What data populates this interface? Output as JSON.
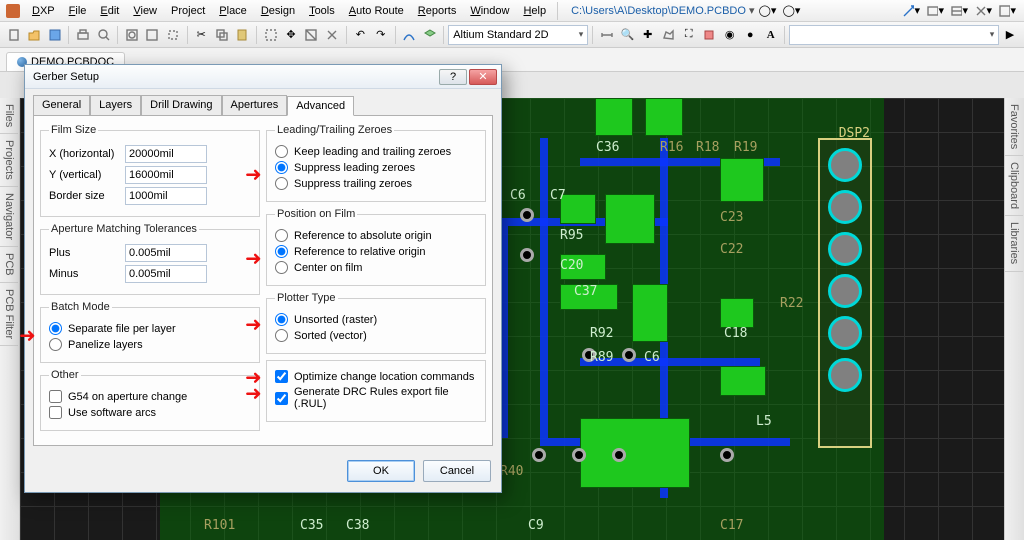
{
  "menu": [
    "DXP",
    "File",
    "Edit",
    "View",
    "Project",
    "Place",
    "Design",
    "Tools",
    "Auto Route",
    "Reports",
    "Window",
    "Help"
  ],
  "filepath": "C:\\Users\\A\\Desktop\\DEMO.PCBDO",
  "layerCombo": "Altium Standard 2D",
  "openFile": "DEMO.PCBDOC",
  "leftRails": [
    "Files",
    "Projects",
    "Navigator",
    "PCB",
    "PCB Filter"
  ],
  "rightRails": [
    "Favorites",
    "Clipboard",
    "Libraries"
  ],
  "dialog": {
    "title": "Gerber Setup",
    "tabs": [
      "General",
      "Layers",
      "Drill Drawing",
      "Apertures",
      "Advanced"
    ],
    "activeTab": 4,
    "filmSize": {
      "legend": "Film Size",
      "x_label": "X (horizontal)",
      "x": "20000mil",
      "y_label": "Y (vertical)",
      "y": "16000mil",
      "b_label": "Border size",
      "b": "1000mil"
    },
    "aperture": {
      "legend": "Aperture Matching Tolerances",
      "plus_label": "Plus",
      "plus": "0.005mil",
      "minus_label": "Minus",
      "minus": "0.005mil"
    },
    "batch": {
      "legend": "Batch Mode",
      "sep": "Separate file per layer",
      "pan": "Panelize layers",
      "sel": "sep"
    },
    "other": {
      "legend": "Other",
      "g54": "G54 on aperture change",
      "arcs": "Use software arcs",
      "g54_chk": false,
      "arcs_chk": false
    },
    "zeros": {
      "legend": "Leading/Trailing Zeroes",
      "keep": "Keep leading and trailing zeroes",
      "slead": "Suppress leading zeroes",
      "strail": "Suppress trailing zeroes",
      "sel": "slead"
    },
    "pos": {
      "legend": "Position on Film",
      "abs": "Reference to absolute origin",
      "rel": "Reference to relative origin",
      "cen": "Center on film",
      "sel": "rel"
    },
    "plotter": {
      "legend": "Plotter Type",
      "uns": "Unsorted (raster)",
      "sort": "Sorted (vector)",
      "sel": "uns"
    },
    "right_other": {
      "opt": "Optimize change location commands",
      "drc": "Generate DRC Rules export file (.RUL)",
      "opt_chk": true,
      "drc_chk": true
    },
    "ok": "OK",
    "cancel": "Cancel"
  },
  "silks": [
    "C36",
    "R16",
    "R18",
    "R19",
    "DSP2",
    "C6",
    "C7",
    "R95",
    "C23",
    "C20",
    "C37",
    "C22",
    "R22",
    "R92",
    "C18",
    "R89",
    "C6",
    "L5",
    "R40",
    "R101",
    "C35",
    "C38",
    "C9",
    "C17"
  ]
}
